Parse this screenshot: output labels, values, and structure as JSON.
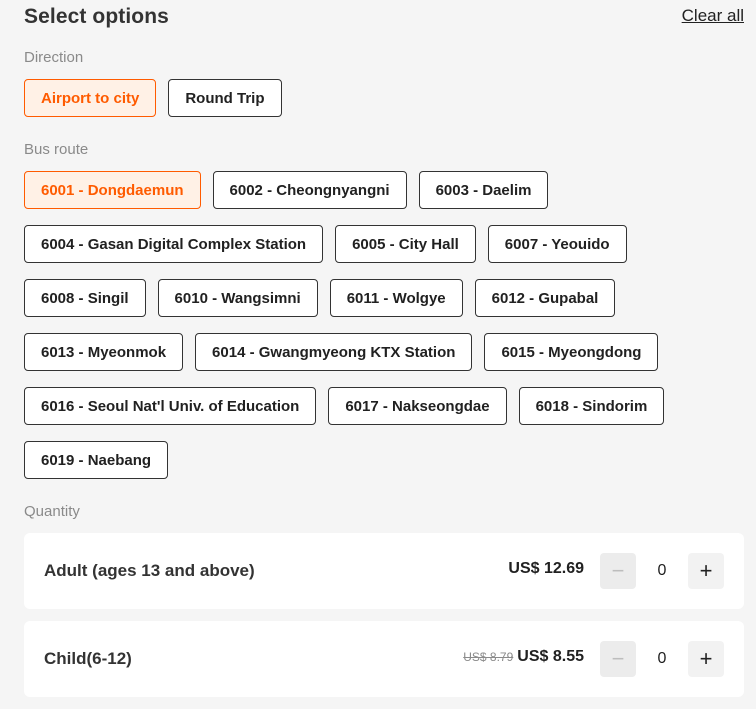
{
  "header": {
    "title": "Select options",
    "clear_all": "Clear all"
  },
  "direction": {
    "label": "Direction",
    "options": [
      "Airport to city",
      "Round Trip"
    ],
    "selected": "Airport to city"
  },
  "bus_route": {
    "label": "Bus route",
    "options": [
      "6001 - Dongdaemun",
      "6002 - Cheongnyangni",
      "6003 - Daelim",
      "6004 - Gasan Digital Complex Station",
      "6005 - City Hall",
      "6007 - Yeouido",
      "6008 - Singil",
      "6010 - Wangsimni",
      "6011 - Wolgye",
      "6012 - Gupabal",
      "6013 - Myeonmok",
      "6014 - Gwangmyeong KTX Station",
      "6015 - Myeongdong",
      "6016 - Seoul Nat'l Univ. of Education",
      "6017 - Nakseongdae",
      "6018 - Sindorim",
      "6019 - Naebang"
    ],
    "selected": "6001 - Dongdaemun"
  },
  "quantity": {
    "label": "Quantity",
    "items": [
      {
        "name": "Adult (ages 13 and above)",
        "old_price": "",
        "price": "US$ 12.69",
        "count": "0",
        "minus": "−",
        "plus": "+"
      },
      {
        "name": "Child(6-12)",
        "old_price": "US$ 8.79",
        "price": "US$ 8.55",
        "count": "0",
        "minus": "−",
        "plus": "+"
      }
    ]
  },
  "colors": {
    "accent": "#ff5b00",
    "accent_bg": "#fff1e6",
    "page_bg": "#f5f5f5"
  }
}
